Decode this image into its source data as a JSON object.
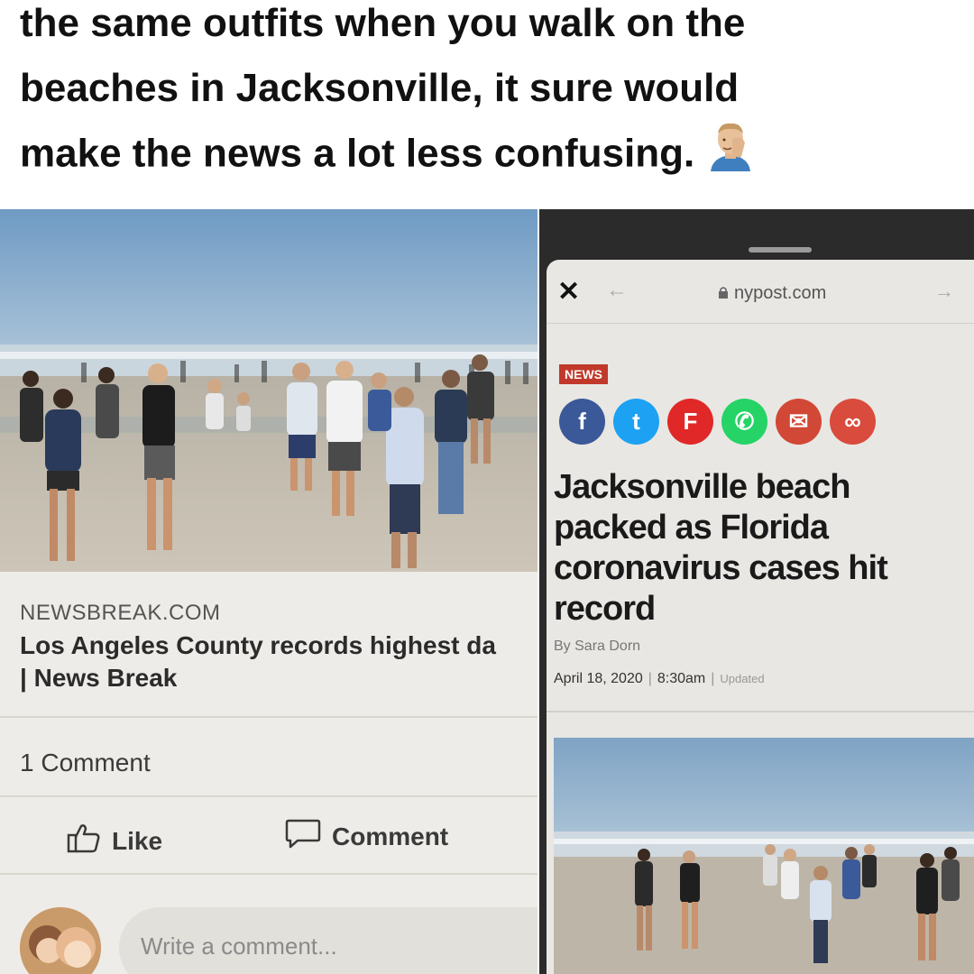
{
  "caption": {
    "lines": [
      "the same outfits when you walk on the",
      "beaches in Jacksonville, it sure would",
      "make the news a lot less confusing."
    ],
    "emoji": "man-facepalming-icon"
  },
  "left_post": {
    "source": "NEWSBREAK.COM",
    "headline_line1": "Los Angeles County records highest da",
    "headline_line2": "| News Break",
    "comment_count": "1 Comment",
    "like_label": "Like",
    "comment_label": "Comment",
    "comment_placeholder": "Write a comment..."
  },
  "right_article": {
    "url": "nypost.com",
    "section_badge": "NEWS",
    "share_icons": [
      {
        "name": "facebook-icon",
        "glyph": "f",
        "color": "#3b5998"
      },
      {
        "name": "twitter-icon",
        "glyph": "t",
        "color": "#1da1f2"
      },
      {
        "name": "flipboard-icon",
        "glyph": "F",
        "color": "#e12828"
      },
      {
        "name": "whatsapp-icon",
        "glyph": "✆",
        "color": "#25d366"
      },
      {
        "name": "email-icon",
        "glyph": "✉",
        "color": "#d14836"
      },
      {
        "name": "link-icon",
        "glyph": "∞",
        "color": "#d94c3d"
      }
    ],
    "title": "Jacksonville beach packed as Florida coronavirus cases hit record",
    "byline": "By Sara Dorn",
    "date": "April 18, 2020",
    "time": "8:30am",
    "updated": "Updated"
  }
}
